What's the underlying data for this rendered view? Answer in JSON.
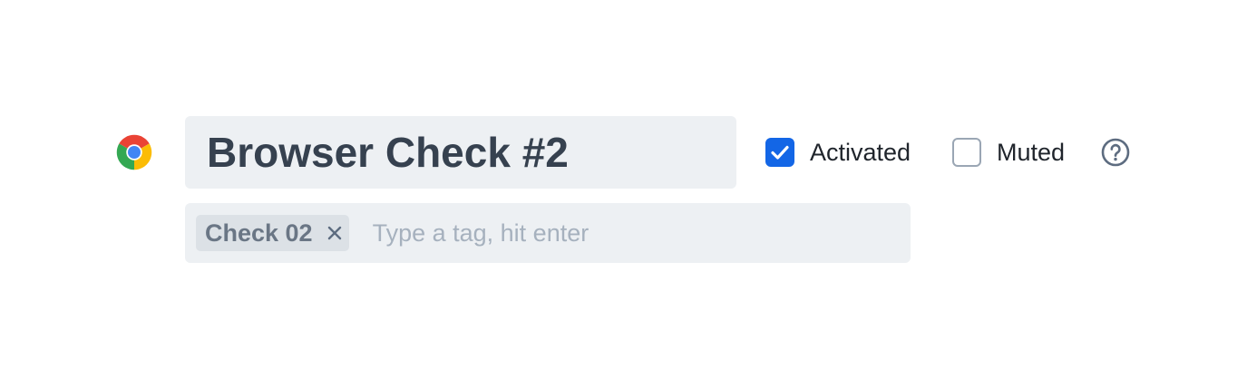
{
  "check": {
    "browser_icon": "chrome-icon",
    "name": "Browser Check #2"
  },
  "options": {
    "activated": {
      "label": "Activated",
      "checked": true
    },
    "muted": {
      "label": "Muted",
      "checked": false
    },
    "help_icon": "question-circle-icon"
  },
  "tags": {
    "items": [
      {
        "label": "Check 02",
        "remove_icon": "close-icon"
      }
    ],
    "placeholder": "Type a tag, hit enter"
  },
  "colors": {
    "accent": "#1366e6",
    "field_background": "#edf0f3",
    "title_text": "#36414f",
    "chip_background": "#dce1e6",
    "chip_text": "#6a7685",
    "placeholder_text": "#a6b1be"
  }
}
